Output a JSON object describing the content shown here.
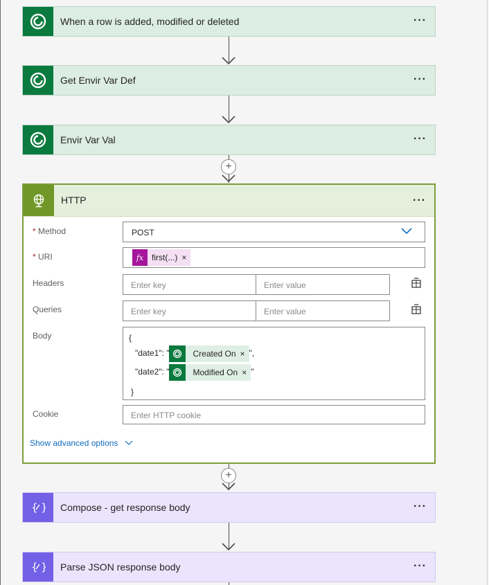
{
  "steps": {
    "trigger": {
      "title": "When a row is added, modified or deleted",
      "more": "···"
    },
    "get_envir_var_def": {
      "title": "Get Envir Var Def",
      "more": "···"
    },
    "envir_var_val": {
      "title": "Envir Var Val",
      "more": "···"
    },
    "compose": {
      "title": "Compose - get response body",
      "more": "···"
    },
    "parse_json": {
      "title": "Parse JSON response body",
      "more": "···"
    }
  },
  "http": {
    "title": "HTTP",
    "more": "···",
    "method": {
      "label": "Method",
      "required_mark": "*",
      "value": "POST"
    },
    "uri": {
      "label": "URI",
      "required_mark": "*",
      "token": "first(...)",
      "token_remove": "×"
    },
    "headers": {
      "label": "Headers",
      "key_placeholder": "Enter key",
      "value_placeholder": "Enter value"
    },
    "queries": {
      "label": "Queries",
      "key_placeholder": "Enter key",
      "value_placeholder": "Enter value"
    },
    "body": {
      "label": "Body",
      "open_brace": "{",
      "close_brace": "}",
      "line1_prefix": "\"date1\": \"",
      "line1_token": "Created On",
      "line1_suffix": "\",",
      "line2_prefix": "\"date2\": \"",
      "line2_token": "Modified On",
      "line2_suffix": "\"",
      "token_remove": "×"
    },
    "cookie": {
      "label": "Cookie",
      "placeholder": "Enter HTTP cookie"
    },
    "advanced_link": "Show advanced options",
    "add_step": "+"
  },
  "colors": {
    "dataverse_green": "#0b7a3e",
    "http_green": "#709727",
    "compose_purple": "#7360e6",
    "expression_magenta": "#a5169c",
    "link_blue": "#0f6cbd"
  },
  "icons": {
    "dataverse": "dataverse-icon",
    "http": "globe-icon",
    "compose": "curly-braces-icon",
    "expression": "fx-icon",
    "switch_mode": "table-switch-icon",
    "dropdown": "chevron-down-icon"
  }
}
